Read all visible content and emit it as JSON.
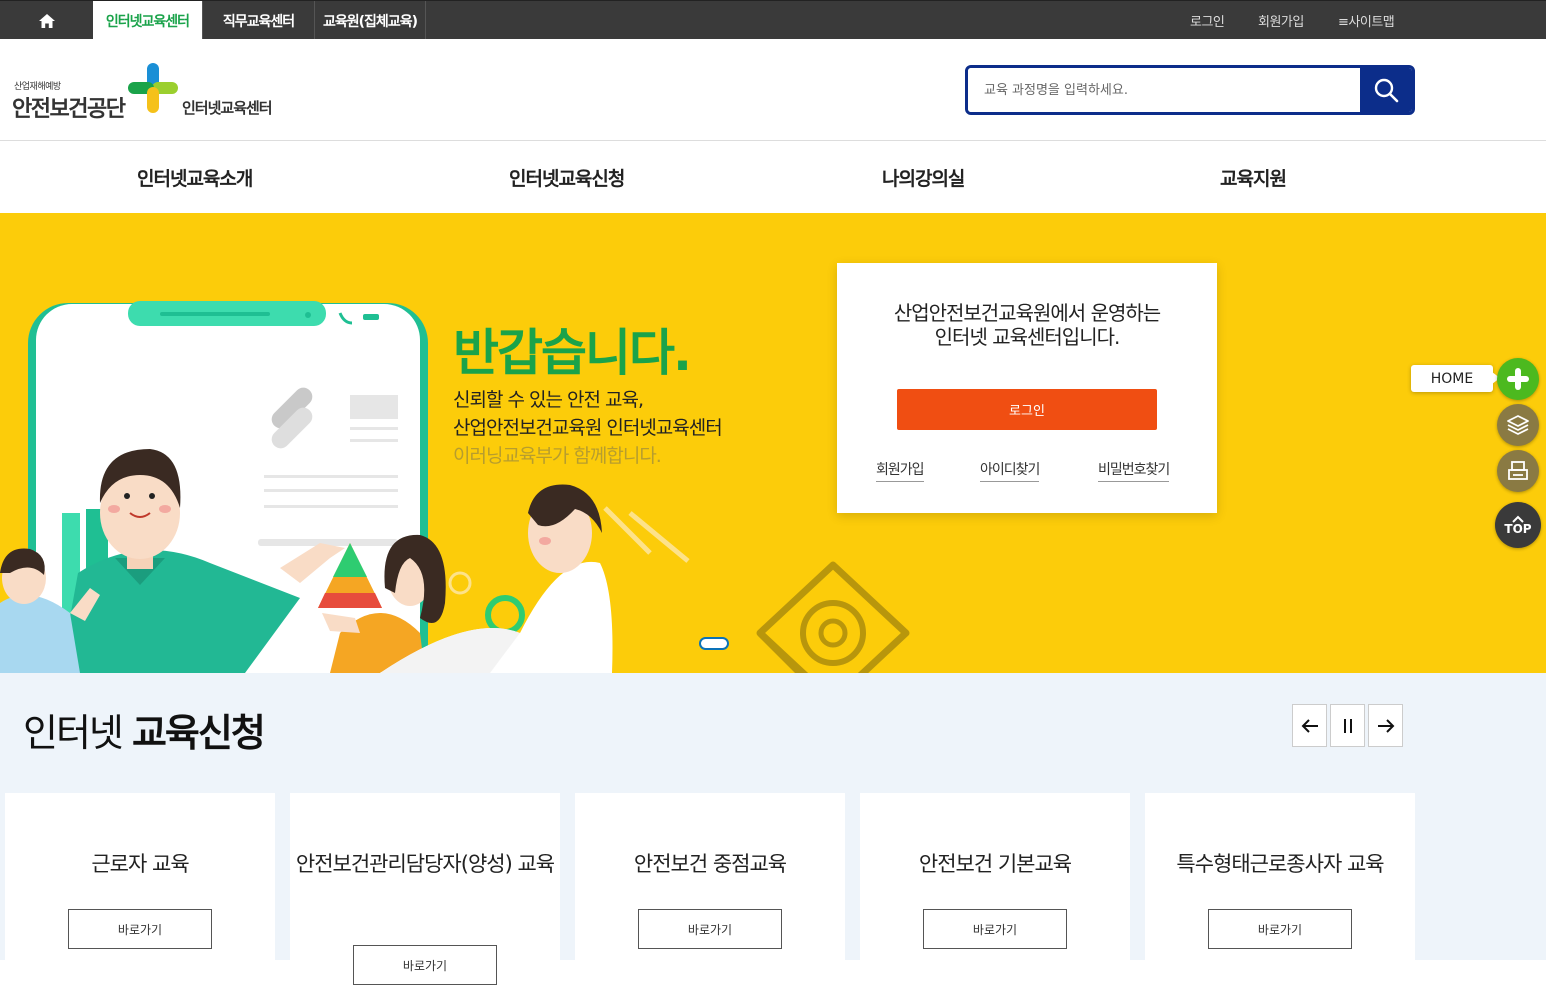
{
  "topbar": {
    "tabs": [
      "인터넷교육센터",
      "직무교육센터",
      "교육원(집체교육)"
    ],
    "util": [
      "로그인",
      "회원가입",
      "≡사이트맵"
    ]
  },
  "header": {
    "logo_small": "산업재해예방",
    "logo_main": "안전보건공단",
    "logo_sub": "인터넷교육센터",
    "search_placeholder": "교육 과정명을 입력하세요."
  },
  "gnb": [
    "인터넷교육소개",
    "인터넷교육신청",
    "나의강의실",
    "교육지원"
  ],
  "hero": {
    "title": "반갑습니다.",
    "line1": "신뢰할 수 있는 안전 교육,",
    "line2": "산업안전보건교육원 인터넷교육센터",
    "line3": "이러닝교육부가 함께합니다.",
    "login_box": {
      "text1": "산업안전보건교육원에서 운영하는",
      "text2": "인터넷 교육센터입니다.",
      "login_button": "로그인",
      "links": [
        "회원가입",
        "아이디찾기",
        "비밀번호찾기"
      ]
    }
  },
  "quick": {
    "home_label": "HOME",
    "top_label": "TOP"
  },
  "section": {
    "title_light": "인터넷 ",
    "title_bold": "교육신청",
    "cards": [
      {
        "title": "근로자 교육",
        "button": "바로가기"
      },
      {
        "title": "안전보건관리담당자(양성) 교육",
        "button": "바로가기"
      },
      {
        "title": "안전보건 중점교육",
        "button": "바로가기"
      },
      {
        "title": "안전보건 기본교육",
        "button": "바로가기"
      },
      {
        "title": "특수형태근로종사자 교육",
        "button": "바로가기"
      }
    ]
  },
  "colors": {
    "accent_green": "#1aa34a",
    "hero_yellow": "#fccc0a",
    "login_orange": "#f04e12",
    "search_navy": "#0c2d8a"
  }
}
